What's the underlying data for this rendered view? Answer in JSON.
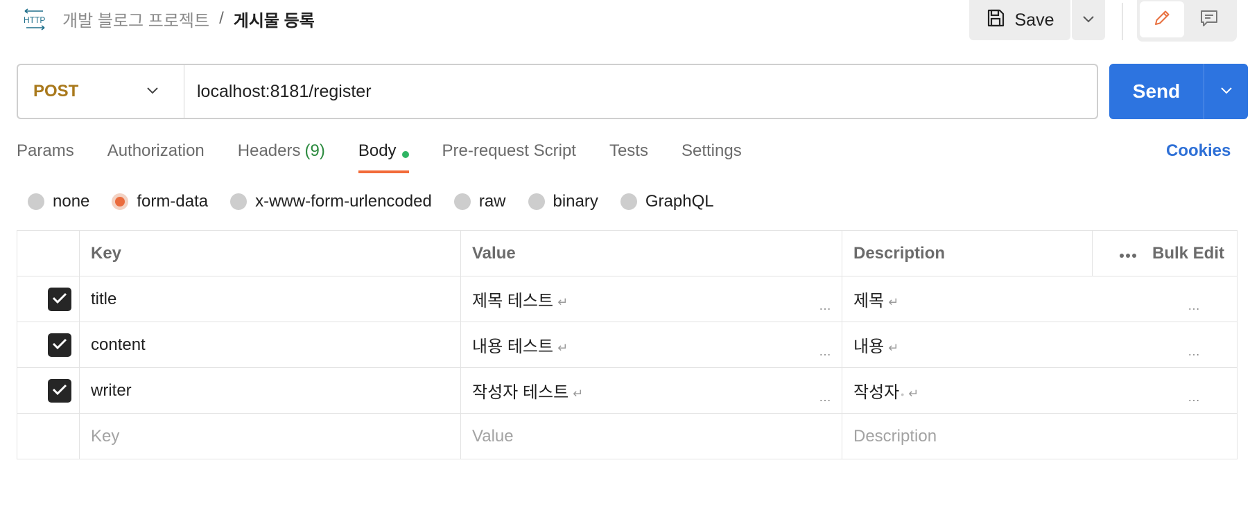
{
  "header": {
    "http_icon_label": "HTTP",
    "collection": "개발 블로그 프로젝트",
    "separator": "/",
    "request_name": "게시물 등록",
    "save_label": "Save"
  },
  "request": {
    "method": "POST",
    "url": "localhost:8181/register",
    "send_label": "Send"
  },
  "tabs": [
    {
      "label": "Params"
    },
    {
      "label": "Authorization"
    },
    {
      "label": "Headers",
      "count": "(9)"
    },
    {
      "label": "Body",
      "active": true
    },
    {
      "label": "Pre-request Script"
    },
    {
      "label": "Tests"
    },
    {
      "label": "Settings"
    }
  ],
  "cookies_label": "Cookies",
  "body_types": [
    {
      "label": "none",
      "selected": false
    },
    {
      "label": "form-data",
      "selected": true
    },
    {
      "label": "x-www-form-urlencoded",
      "selected": false
    },
    {
      "label": "raw",
      "selected": false
    },
    {
      "label": "binary",
      "selected": false
    },
    {
      "label": "GraphQL",
      "selected": false
    }
  ],
  "table": {
    "headers": {
      "key": "Key",
      "value": "Value",
      "description": "Description",
      "bulk_edit": "Bulk Edit"
    },
    "rows": [
      {
        "checked": true,
        "key": "title",
        "value": "제목 테스트",
        "description": "제목"
      },
      {
        "checked": true,
        "key": "content",
        "value": "내용 테스트",
        "description": "내용"
      },
      {
        "checked": true,
        "key": "writer",
        "value": "작성자 테스트",
        "description": "작성자"
      }
    ],
    "placeholders": {
      "key": "Key",
      "value": "Value",
      "description": "Description"
    }
  },
  "colors": {
    "method": "#a9791c",
    "send": "#2d74e0",
    "active_tab_underline": "#f26b3a",
    "body_dot": "#2fb463",
    "headers_count": "#2b8a3e",
    "cookies": "#2d6fd6",
    "radio_selected": "#ea6b3d"
  }
}
